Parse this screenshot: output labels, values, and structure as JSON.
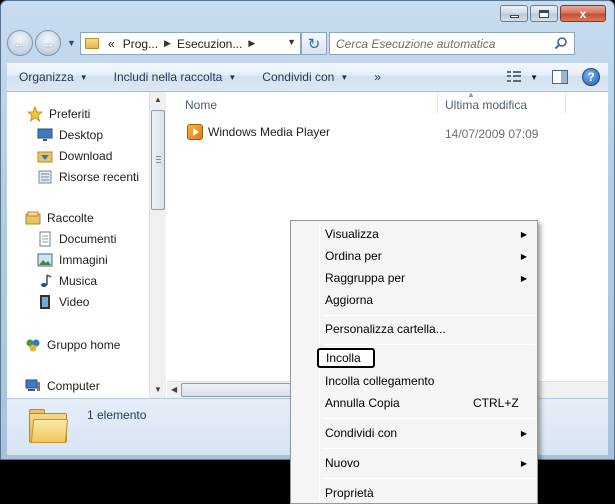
{
  "window": {
    "close_glyph": "x"
  },
  "address": {
    "overflow": "«",
    "crumbs": [
      "Prog...",
      "Esecuzion..."
    ]
  },
  "search": {
    "placeholder": "Cerca Esecuzione automatica"
  },
  "toolbar": {
    "items": [
      "Organizza",
      "Includi nella raccolta",
      "Condividi con"
    ],
    "more": "»"
  },
  "navpane": {
    "favorites": {
      "header": "Preferiti",
      "items": [
        "Desktop",
        "Download",
        "Risorse recenti"
      ]
    },
    "libraries": {
      "header": "Raccolte",
      "items": [
        "Documenti",
        "Immagini",
        "Musica",
        "Video"
      ]
    },
    "homegroup": "Gruppo home",
    "computer": "Computer"
  },
  "filelist": {
    "columns": [
      "Nome",
      "Ultima modifica"
    ],
    "files": [
      {
        "name": "Windows Media Player",
        "modified": "14/07/2009 07:09"
      }
    ]
  },
  "details": {
    "count": "1 elemento"
  },
  "contextmenu": {
    "items": [
      {
        "label": "Visualizza",
        "submenu": true
      },
      {
        "label": "Ordina per",
        "submenu": true
      },
      {
        "label": "Raggruppa per",
        "submenu": true
      },
      {
        "label": "Aggiorna",
        "submenu": false
      },
      {
        "label": "Personalizza cartella...",
        "submenu": false
      },
      {
        "label": "Incolla",
        "submenu": false,
        "highlighted": true
      },
      {
        "label": "Incolla collegamento",
        "submenu": false
      },
      {
        "label": "Annulla Copia",
        "submenu": false,
        "shortcut": "CTRL+Z"
      },
      {
        "label": "Condividi con",
        "submenu": true
      },
      {
        "label": "Nuovo",
        "submenu": true
      },
      {
        "label": "Proprietà",
        "submenu": false
      }
    ]
  },
  "colors": {
    "frame": "#b4cde6",
    "command_bar": "#dde8f4",
    "menu_bg": "#f5f5f5",
    "link_text": "#1e395b"
  }
}
